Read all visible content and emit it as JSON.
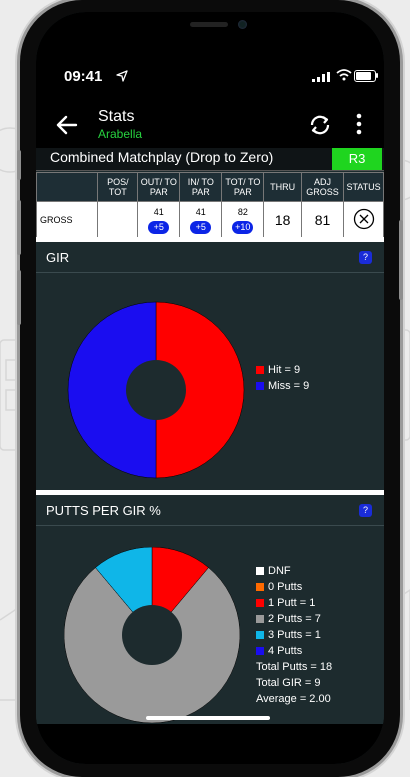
{
  "status": {
    "time": "09:41"
  },
  "header": {
    "title": "Stats",
    "subtitle": "Arabella"
  },
  "competition": {
    "name": "Combined Matchplay (Drop to Zero)",
    "round": "R3"
  },
  "score_table": {
    "headers": [
      "",
      "POS/ TOT",
      "OUT/ TO PAR",
      "IN/ TO PAR",
      "TOT/ TO PAR",
      "THRU",
      "ADJ GROSS",
      "STATUS"
    ],
    "row": {
      "label": "GROSS",
      "pos_tot": "",
      "out": "41",
      "out_par": "+5",
      "in": "41",
      "in_par": "+5",
      "tot": "82",
      "tot_par": "+10",
      "thru": "18",
      "adj_gross": "81"
    }
  },
  "gir": {
    "title": "GIR",
    "help": "?",
    "legend": [
      "Hit = 9",
      "Miss = 9"
    ]
  },
  "putts": {
    "title": "PUTTS PER GIR %",
    "help": "?",
    "legend": [
      "DNF",
      "0 Putts",
      "1 Putt = 1",
      "2 Putts = 7",
      "3 Putts = 1",
      "4 Putts"
    ],
    "totals": [
      "Total Putts = 18",
      "Total GIR = 9",
      "Average = 2.00"
    ]
  },
  "chart_data": [
    {
      "type": "pie",
      "title": "GIR",
      "categories": [
        "Hit",
        "Miss"
      ],
      "values": [
        9,
        9
      ],
      "colors": [
        "#ff0000",
        "#1a0df0"
      ]
    },
    {
      "type": "pie",
      "title": "PUTTS PER GIR %",
      "categories": [
        "DNF",
        "0 Putts",
        "1 Putt",
        "2 Putts",
        "3 Putts",
        "4 Putts"
      ],
      "values": [
        0,
        0,
        1,
        7,
        1,
        0
      ],
      "colors": [
        "#ffffff",
        "#ff6a00",
        "#ff0000",
        "#9a9a9a",
        "#0fb6e8",
        "#1a0df0"
      ]
    }
  ],
  "colors": {
    "accent_green": "#1fd51f",
    "subtitle_green": "#27d23f",
    "badge_blue": "#0c25e6"
  }
}
